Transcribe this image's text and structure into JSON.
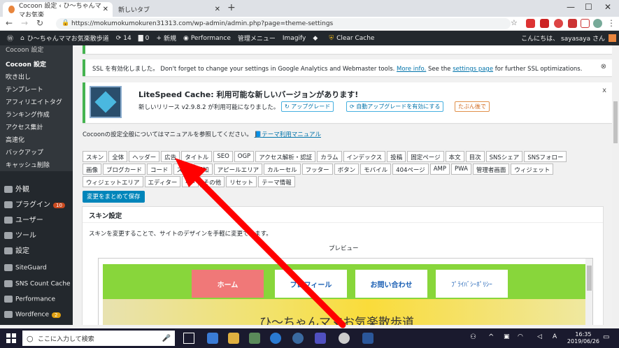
{
  "browser": {
    "tabs": [
      {
        "label": "Cocoon 設定 ‹ ひ〜ちゃんママお気楽",
        "active": true
      },
      {
        "label": "新しいタブ",
        "active": false
      }
    ],
    "url": "https://mokumokumokuren31313.com/wp-admin/admin.php?page=theme-settings"
  },
  "wpbar": {
    "site": "ひ〜ちゃんママお気楽散歩道",
    "updates": "14",
    "comments": "0",
    "new": "新規",
    "performance": "Performance",
    "admin_menu": "管理メニュー",
    "imagify": "Imagify",
    "clear_cache": "Clear Cache",
    "greeting": "こんにちは、 sayasaya さん"
  },
  "sidebar": {
    "top_label": "Cocoon 設定",
    "items": [
      "Cocoon 設定",
      "吹き出し",
      "テンプレート",
      "アフィリエイトタグ",
      "ランキング作成",
      "アクセス集計",
      "高速化",
      "バックアップ",
      "キャッシュ削除"
    ],
    "main": [
      {
        "label": "外観",
        "badge": ""
      },
      {
        "label": "プラグイン",
        "badge": "10"
      },
      {
        "label": "ユーザー",
        "badge": ""
      },
      {
        "label": "ツール",
        "badge": ""
      },
      {
        "label": "設定",
        "badge": ""
      },
      {
        "label": "SiteGuard",
        "badge": ""
      },
      {
        "label": "SNS Count Cache",
        "badge": ""
      },
      {
        "label": "Performance",
        "badge": ""
      },
      {
        "label": "Wordfence",
        "badge": "2"
      }
    ]
  },
  "notices": {
    "ssl": {
      "text": "SSL を有効化しました。 Don't forget to change your settings in Google Analytics and Webmaster tools.",
      "more": "More info.",
      "see": "See the",
      "settings_page": "settings page",
      "tail": "for further SSL optimizations."
    },
    "litespeed": {
      "title": "LiteSpeed Cache: 利用可能な新しいバージョンがあります!",
      "body": "新しいリリース v2.9.8.2 が利用可能になりました。",
      "upgrade": "アップグレード",
      "auto_upgrade": "自動アップグレードを有効にする",
      "later": "たぶん後で",
      "close": "x"
    }
  },
  "manual": {
    "text": "Cocoonの設定全般についてはマニュアルを参照してください。",
    "link": "テーマ利用マニュアル"
  },
  "settings_tabs": {
    "row1": [
      "スキン",
      "全体",
      "ヘッダー",
      "広告",
      "タイトル",
      "SEO",
      "OGP",
      "アクセス解析・認証",
      "カラム",
      "インデックス",
      "投稿",
      "固定ページ",
      "本文",
      "目次",
      "SNSシェア",
      "SNSフォロー"
    ],
    "row2": [
      "画像",
      "ブログカード",
      "コード",
      "スキ",
      "通知",
      "アピールエリア",
      "カルーセル",
      "フッター",
      "ボタン",
      "モバイル",
      "404ページ",
      "AMP",
      "PWA",
      "管理者画面",
      "ウィジェット"
    ],
    "row3": [
      "ウィジェットエリア",
      "エディター",
      "AM",
      "その他",
      "リセット",
      "テーマ情報"
    ]
  },
  "save_button": "変更をまとめて保存",
  "panel": {
    "heading": "スキン設定",
    "desc": "スキンを変更することで、サイトのデザインを手軽に変更できます。",
    "preview_label": "プレビュー",
    "preview_nav": [
      "ホーム",
      "プロフィール",
      "お問い合わせ",
      "ﾌﾟﾗｲﾊﾞｼｰﾎﾟﾘｼｰ"
    ],
    "preview_title": "ひ〜ちゃんママお気楽散歩道"
  },
  "taskbar": {
    "search": "ここに入力して検索",
    "time": "16:35",
    "date": "2019/06/26",
    "lang": "A"
  }
}
